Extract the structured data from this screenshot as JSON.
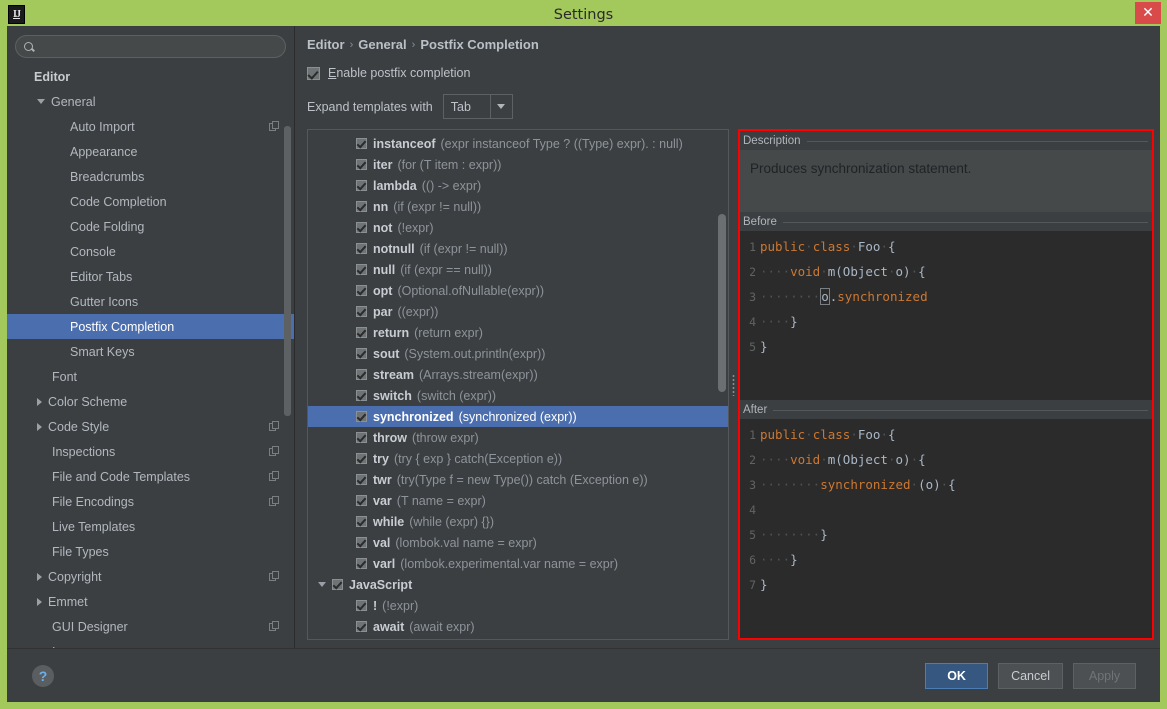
{
  "window": {
    "title": "Settings",
    "app_icon_label": "IJ",
    "close_label": "✕",
    "titlebar_color": "#a3c85c",
    "accent_selection": "#4b6eaf",
    "highlight_border": "#ff0000"
  },
  "search": {
    "value": "",
    "placeholder": ""
  },
  "sidebar": {
    "items": [
      {
        "label": "Editor",
        "depth": 0,
        "arrow": "none",
        "bold": true,
        "selected": false,
        "copy": false
      },
      {
        "label": "General",
        "depth": 1,
        "arrow": "down",
        "bold": false,
        "selected": false,
        "copy": false
      },
      {
        "label": "Auto Import",
        "depth": 2,
        "arrow": "none",
        "bold": false,
        "selected": false,
        "copy": true
      },
      {
        "label": "Appearance",
        "depth": 2,
        "arrow": "none",
        "bold": false,
        "selected": false,
        "copy": false
      },
      {
        "label": "Breadcrumbs",
        "depth": 2,
        "arrow": "none",
        "bold": false,
        "selected": false,
        "copy": false
      },
      {
        "label": "Code Completion",
        "depth": 2,
        "arrow": "none",
        "bold": false,
        "selected": false,
        "copy": false
      },
      {
        "label": "Code Folding",
        "depth": 2,
        "arrow": "none",
        "bold": false,
        "selected": false,
        "copy": false
      },
      {
        "label": "Console",
        "depth": 2,
        "arrow": "none",
        "bold": false,
        "selected": false,
        "copy": false
      },
      {
        "label": "Editor Tabs",
        "depth": 2,
        "arrow": "none",
        "bold": false,
        "selected": false,
        "copy": false
      },
      {
        "label": "Gutter Icons",
        "depth": 2,
        "arrow": "none",
        "bold": false,
        "selected": false,
        "copy": false
      },
      {
        "label": "Postfix Completion",
        "depth": 2,
        "arrow": "none",
        "bold": false,
        "selected": true,
        "copy": false
      },
      {
        "label": "Smart Keys",
        "depth": 2,
        "arrow": "none",
        "bold": false,
        "selected": false,
        "copy": false
      },
      {
        "label": "Font",
        "depth": 1,
        "arrow": "none",
        "bold": false,
        "selected": false,
        "copy": false
      },
      {
        "label": "Color Scheme",
        "depth": 1,
        "arrow": "right",
        "bold": false,
        "selected": false,
        "copy": false
      },
      {
        "label": "Code Style",
        "depth": 1,
        "arrow": "right",
        "bold": false,
        "selected": false,
        "copy": true
      },
      {
        "label": "Inspections",
        "depth": 1,
        "arrow": "none",
        "bold": false,
        "selected": false,
        "copy": true
      },
      {
        "label": "File and Code Templates",
        "depth": 1,
        "arrow": "none",
        "bold": false,
        "selected": false,
        "copy": true
      },
      {
        "label": "File Encodings",
        "depth": 1,
        "arrow": "none",
        "bold": false,
        "selected": false,
        "copy": true
      },
      {
        "label": "Live Templates",
        "depth": 1,
        "arrow": "none",
        "bold": false,
        "selected": false,
        "copy": false
      },
      {
        "label": "File Types",
        "depth": 1,
        "arrow": "none",
        "bold": false,
        "selected": false,
        "copy": false
      },
      {
        "label": "Copyright",
        "depth": 1,
        "arrow": "right",
        "bold": false,
        "selected": false,
        "copy": true
      },
      {
        "label": "Emmet",
        "depth": 1,
        "arrow": "right",
        "bold": false,
        "selected": false,
        "copy": false
      },
      {
        "label": "GUI Designer",
        "depth": 1,
        "arrow": "none",
        "bold": false,
        "selected": false,
        "copy": true
      },
      {
        "label": "Images",
        "depth": 1,
        "arrow": "none",
        "bold": false,
        "selected": false,
        "copy": false
      }
    ]
  },
  "main": {
    "breadcrumb": [
      "Editor",
      "General",
      "Postfix Completion"
    ],
    "breadcrumb_separator": "›",
    "enable_checkbox": {
      "label": "Enable postfix completion",
      "mnemonic": "E",
      "checked": true
    },
    "expand_with": {
      "label": "Expand templates with",
      "value": "Tab"
    }
  },
  "templates": [
    {
      "name": "instanceof",
      "expr": "(expr instanceof Type ? ((Type) expr). : null)",
      "checked": true,
      "indent": 1,
      "selected": false,
      "group": false,
      "arrow": "none"
    },
    {
      "name": "iter",
      "expr": "(for (T item : expr))",
      "checked": true,
      "indent": 1,
      "selected": false,
      "group": false,
      "arrow": "none"
    },
    {
      "name": "lambda",
      "expr": "(() -> expr)",
      "checked": true,
      "indent": 1,
      "selected": false,
      "group": false,
      "arrow": "none"
    },
    {
      "name": "nn",
      "expr": "(if (expr != null))",
      "checked": true,
      "indent": 1,
      "selected": false,
      "group": false,
      "arrow": "none"
    },
    {
      "name": "not",
      "expr": "(!expr)",
      "checked": true,
      "indent": 1,
      "selected": false,
      "group": false,
      "arrow": "none"
    },
    {
      "name": "notnull",
      "expr": "(if (expr != null))",
      "checked": true,
      "indent": 1,
      "selected": false,
      "group": false,
      "arrow": "none"
    },
    {
      "name": "null",
      "expr": "(if (expr == null))",
      "checked": true,
      "indent": 1,
      "selected": false,
      "group": false,
      "arrow": "none"
    },
    {
      "name": "opt",
      "expr": "(Optional.ofNullable(expr))",
      "checked": true,
      "indent": 1,
      "selected": false,
      "group": false,
      "arrow": "none"
    },
    {
      "name": "par",
      "expr": "((expr))",
      "checked": true,
      "indent": 1,
      "selected": false,
      "group": false,
      "arrow": "none"
    },
    {
      "name": "return",
      "expr": "(return expr)",
      "checked": true,
      "indent": 1,
      "selected": false,
      "group": false,
      "arrow": "none"
    },
    {
      "name": "sout",
      "expr": "(System.out.println(expr))",
      "checked": true,
      "indent": 1,
      "selected": false,
      "group": false,
      "arrow": "none"
    },
    {
      "name": "stream",
      "expr": "(Arrays.stream(expr))",
      "checked": true,
      "indent": 1,
      "selected": false,
      "group": false,
      "arrow": "none"
    },
    {
      "name": "switch",
      "expr": "(switch (expr))",
      "checked": true,
      "indent": 1,
      "selected": false,
      "group": false,
      "arrow": "none"
    },
    {
      "name": "synchronized",
      "expr": "(synchronized (expr))",
      "checked": true,
      "indent": 1,
      "selected": true,
      "group": false,
      "arrow": "none"
    },
    {
      "name": "throw",
      "expr": "(throw expr)",
      "checked": true,
      "indent": 1,
      "selected": false,
      "group": false,
      "arrow": "none"
    },
    {
      "name": "try",
      "expr": "(try { exp } catch(Exception e))",
      "checked": true,
      "indent": 1,
      "selected": false,
      "group": false,
      "arrow": "none"
    },
    {
      "name": "twr",
      "expr": "(try(Type f = new Type()) catch (Exception e))",
      "checked": true,
      "indent": 1,
      "selected": false,
      "group": false,
      "arrow": "none"
    },
    {
      "name": "var",
      "expr": "(T name = expr)",
      "checked": true,
      "indent": 1,
      "selected": false,
      "group": false,
      "arrow": "none"
    },
    {
      "name": "while",
      "expr": "(while (expr) {})",
      "checked": true,
      "indent": 1,
      "selected": false,
      "group": false,
      "arrow": "none"
    },
    {
      "name": "val",
      "expr": "(lombok.val name = expr)",
      "checked": true,
      "indent": 1,
      "selected": false,
      "group": false,
      "arrow": "none"
    },
    {
      "name": "varl",
      "expr": "(lombok.experimental.var name = expr)",
      "checked": true,
      "indent": 1,
      "selected": false,
      "group": false,
      "arrow": "none"
    },
    {
      "name": "JavaScript",
      "expr": "",
      "checked": true,
      "indent": 0,
      "selected": false,
      "group": true,
      "arrow": "down"
    },
    {
      "name": "!",
      "expr": "(!expr)",
      "checked": true,
      "indent": 1,
      "selected": false,
      "group": false,
      "arrow": "none"
    },
    {
      "name": "await",
      "expr": "(await expr)",
      "checked": true,
      "indent": 1,
      "selected": false,
      "group": false,
      "arrow": "none"
    }
  ],
  "detail": {
    "description_title": "Description",
    "description_text": "Produces synchronization statement.",
    "before_title": "Before",
    "after_title": "After",
    "before_code": [
      {
        "n": "1",
        "ws": "",
        "parts": [
          {
            "t": "public",
            "c": "kw"
          },
          {
            "t": " ",
            "c": "ws"
          },
          {
            "t": "class",
            "c": "kw"
          },
          {
            "t": " ",
            "c": "ws"
          },
          {
            "t": "Foo",
            "c": "code"
          },
          {
            "t": " ",
            "c": "ws"
          },
          {
            "t": "{",
            "c": "code"
          }
        ]
      },
      {
        "n": "2",
        "ws": "    ",
        "parts": [
          {
            "t": "void",
            "c": "kw"
          },
          {
            "t": " ",
            "c": "ws"
          },
          {
            "t": "m(Object",
            "c": "code"
          },
          {
            "t": " ",
            "c": "ws"
          },
          {
            "t": "o)",
            "c": "code"
          },
          {
            "t": " ",
            "c": "ws"
          },
          {
            "t": "{",
            "c": "code"
          }
        ]
      },
      {
        "n": "3",
        "ws": "        ",
        "parts": [
          {
            "t": "o",
            "c": "caret"
          },
          {
            "t": ".",
            "c": "code"
          },
          {
            "t": "synchronized",
            "c": "kw"
          }
        ]
      },
      {
        "n": "4",
        "ws": "    ",
        "parts": [
          {
            "t": "}",
            "c": "code"
          }
        ]
      },
      {
        "n": "5",
        "ws": "",
        "parts": [
          {
            "t": "}",
            "c": "code"
          }
        ]
      }
    ],
    "after_code": [
      {
        "n": "1",
        "ws": "",
        "parts": [
          {
            "t": "public",
            "c": "kw"
          },
          {
            "t": " ",
            "c": "ws"
          },
          {
            "t": "class",
            "c": "kw"
          },
          {
            "t": " ",
            "c": "ws"
          },
          {
            "t": "Foo",
            "c": "code"
          },
          {
            "t": " ",
            "c": "ws"
          },
          {
            "t": "{",
            "c": "code"
          }
        ]
      },
      {
        "n": "2",
        "ws": "    ",
        "parts": [
          {
            "t": "void",
            "c": "kw"
          },
          {
            "t": " ",
            "c": "ws"
          },
          {
            "t": "m(Object",
            "c": "code"
          },
          {
            "t": " ",
            "c": "ws"
          },
          {
            "t": "o)",
            "c": "code"
          },
          {
            "t": " ",
            "c": "ws"
          },
          {
            "t": "{",
            "c": "code"
          }
        ]
      },
      {
        "n": "3",
        "ws": "        ",
        "parts": [
          {
            "t": "synchronized",
            "c": "kw"
          },
          {
            "t": " ",
            "c": "ws"
          },
          {
            "t": "(o)",
            "c": "code"
          },
          {
            "t": " ",
            "c": "ws"
          },
          {
            "t": "{",
            "c": "code"
          }
        ]
      },
      {
        "n": "4",
        "ws": "",
        "parts": []
      },
      {
        "n": "5",
        "ws": "        ",
        "parts": [
          {
            "t": "}",
            "c": "code"
          }
        ]
      },
      {
        "n": "6",
        "ws": "    ",
        "parts": [
          {
            "t": "}",
            "c": "code"
          }
        ]
      },
      {
        "n": "7",
        "ws": "",
        "parts": [
          {
            "t": "}",
            "c": "code"
          }
        ]
      }
    ]
  },
  "footer": {
    "help_label": "?",
    "buttons": [
      {
        "label": "OK",
        "style": "primary"
      },
      {
        "label": "Cancel",
        "style": "normal"
      },
      {
        "label": "Apply",
        "style": "disabled"
      }
    ]
  }
}
